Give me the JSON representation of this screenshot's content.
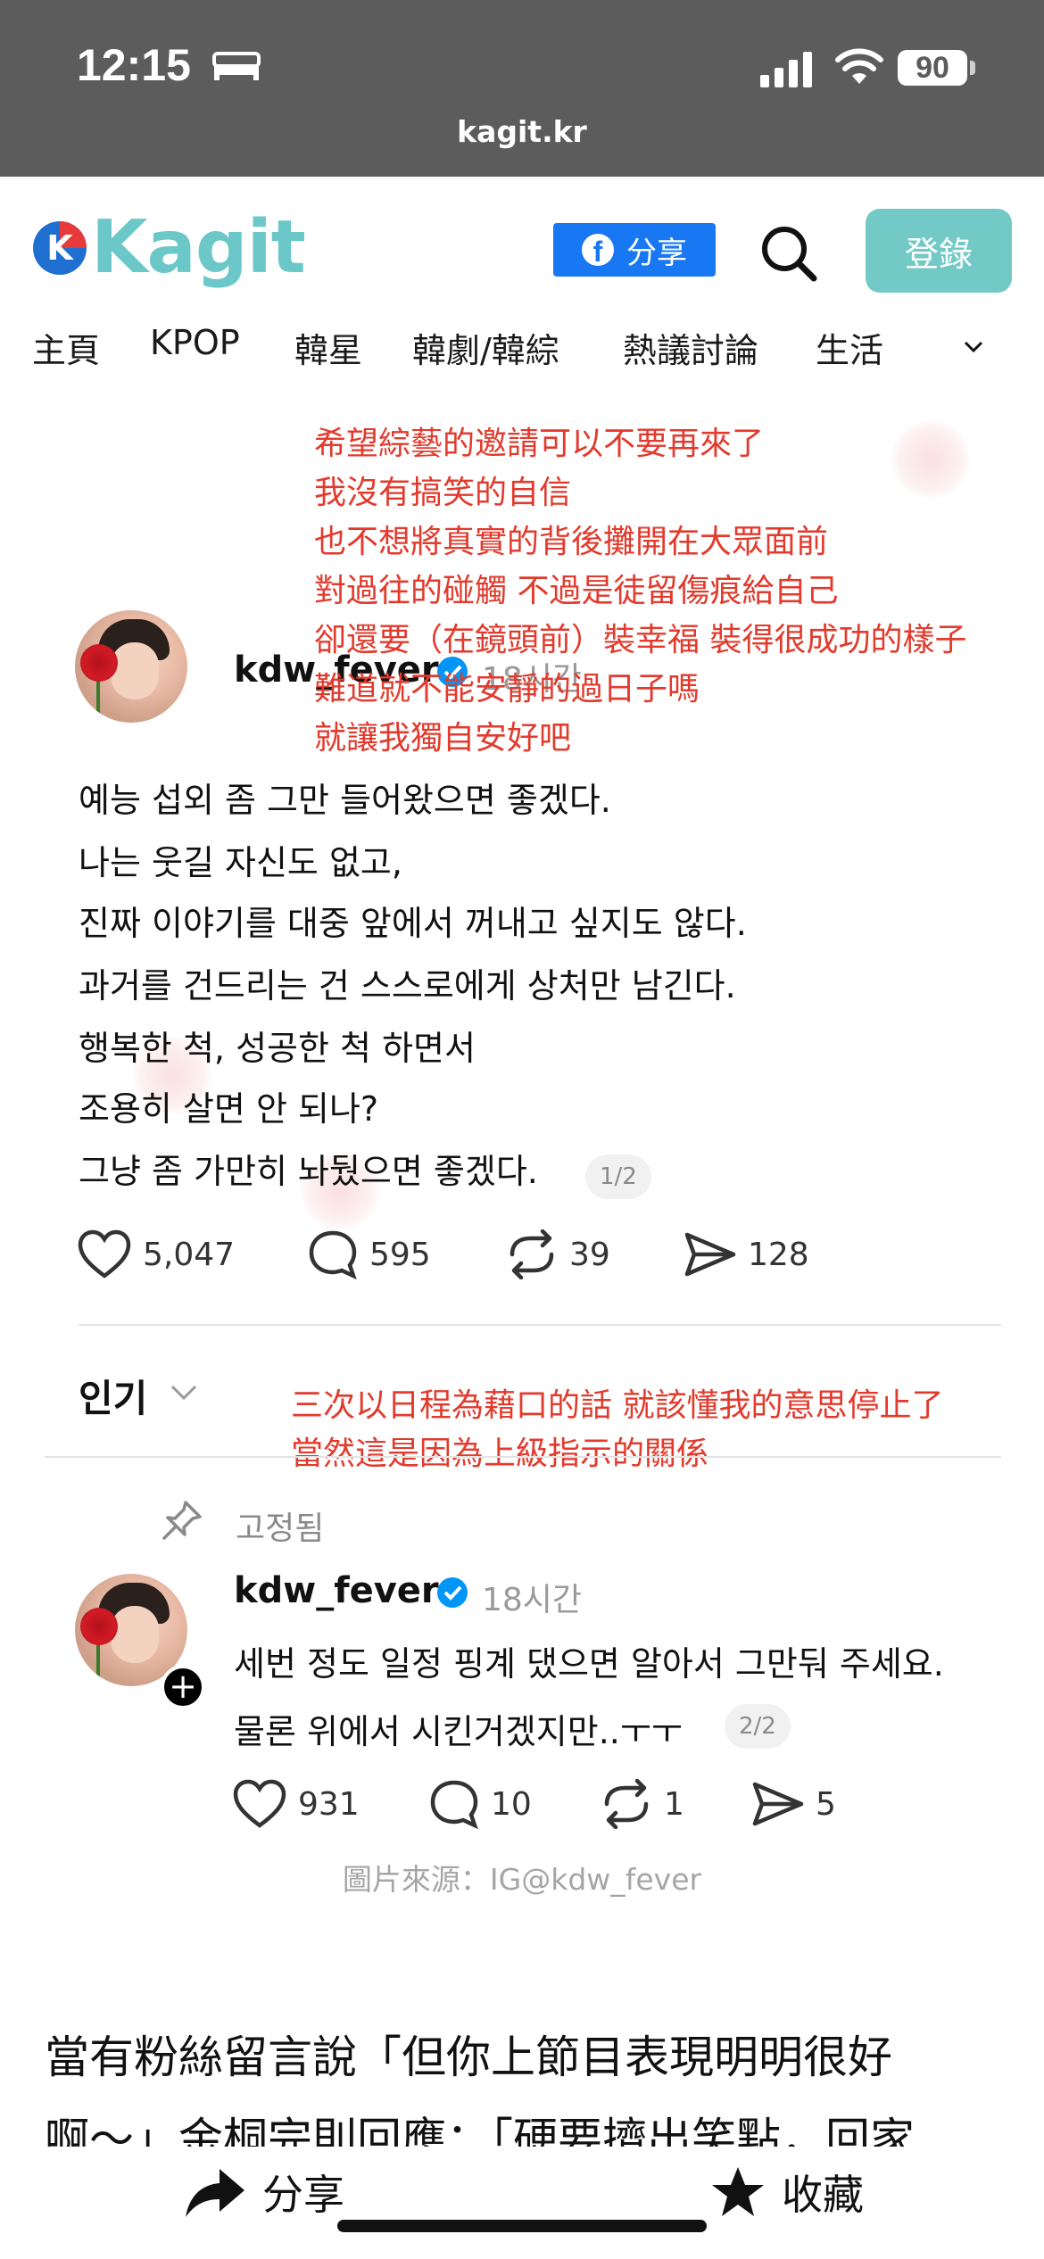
{
  "status_bar": {
    "time": "12:15",
    "battery": "90",
    "url": "kagit.kr"
  },
  "header": {
    "logo_text": "Kagit",
    "share_label": "分享",
    "login_label": "登錄",
    "facebook_glyph": "f"
  },
  "nav": {
    "items": [
      "主頁",
      "KPOP",
      "韓星",
      "韓劇/韓綜",
      "熱議討論",
      "生活"
    ]
  },
  "translation_top": [
    "希望綜藝的邀請可以不要再來了",
    "我沒有搞笑的自信",
    "也不想將真實的背後攤開在大眾面前",
    "對過往的碰觸 不過是徒留傷痕給自己",
    "卻還要（在鏡頭前）裝幸福 裝得很成功的樣子",
    "難道就不能安靜的過日子嗎",
    "就讓我獨自安好吧"
  ],
  "post1": {
    "username": "kdw_fever",
    "timestamp": "18시간",
    "lines": [
      "예능 섭외 좀 그만 들어왔으면 좋겠다.",
      "나는 웃길 자신도 없고,",
      "진짜 이야기를 대중 앞에서 꺼내고 싶지도 않다.",
      "과거를 건드리는 건 스스로에게 상처만 남긴다.",
      "행복한 척, 성공한 척 하면서",
      "조용히 살면 안 되나?",
      "그냥 좀 가만히 놔뒀으면 좋겠다."
    ],
    "page": "1/2",
    "likes": "5,047",
    "comments": "595",
    "reposts": "39",
    "shares": "128"
  },
  "popular_label": "인기",
  "translation_bottom": [
    "三次以日程為藉口的話 就該懂我的意思停止了",
    "當然這是因為上級指示的關係"
  ],
  "pinned_label": "고정됨",
  "post2": {
    "username": "kdw_fever",
    "timestamp": "18시간",
    "lines": [
      "세번 정도 일정 핑계 댔으면 알아서 그만둬 주세요.",
      "물론 위에서 시킨거겠지만..ㅜㅜ"
    ],
    "page": "2/2",
    "likes": "931",
    "comments": "10",
    "reposts": "1",
    "shares": "5"
  },
  "image_caption": "圖片來源：IG@kdw_fever",
  "article": {
    "line1": "當有粉絲留言說「但你上節目表現明明很好",
    "line2": "啊～」金桐完則回應：「硬要擠出笑點，回家"
  },
  "bottom_bar": {
    "share_label": "分享",
    "favorite_label": "收藏"
  },
  "colors": {
    "brand": "#6cc7c9",
    "login": "#72c9c6",
    "facebook": "#1877f2",
    "translation": "#e23a2c",
    "verified": "#0095f6"
  },
  "icons": [
    "bed-icon",
    "signal-icon",
    "wifi-icon",
    "battery-icon",
    "search-icon",
    "chevron-down-icon",
    "verified-icon",
    "heart-icon",
    "comment-icon",
    "repost-icon",
    "send-icon",
    "pin-icon",
    "share-arrow-icon",
    "star-icon"
  ]
}
